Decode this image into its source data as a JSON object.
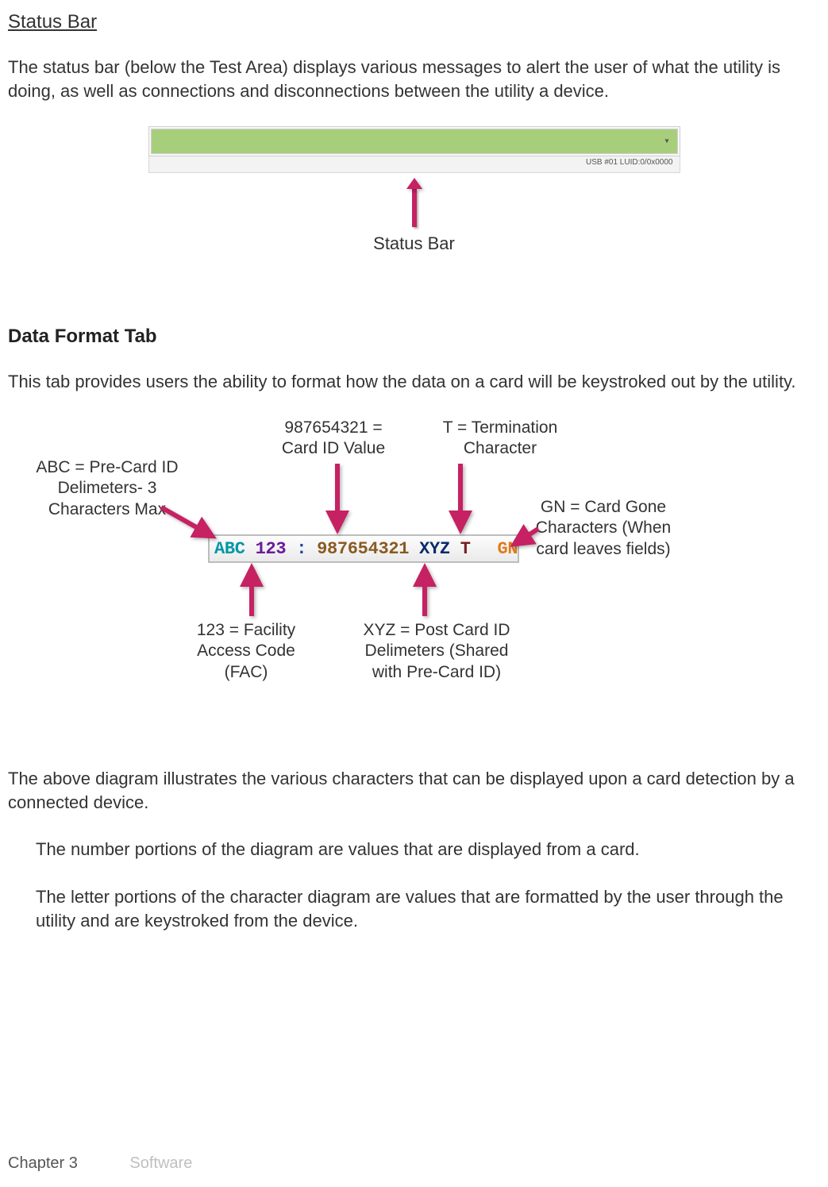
{
  "title": "Status Bar",
  "intro": "The status bar (below the Test Area) displays various messages to alert the user of what the utility is doing, as well as connections and disconnections between the utility a device.",
  "statusStripText": "USB #01 LUID:0/0x0000",
  "statusCaption": "Status Bar",
  "dataFormatHeading": "Data Format Tab",
  "dataFormatIntro": "This tab provides users the ability to format how the data on a card will be keystroked out by the utility.",
  "callouts": {
    "abc": "ABC = Pre-Card ID Delimeters- 3 Characters Max",
    "cid": "987654321 = Card ID Value",
    "term": "T = Termination Character",
    "gone": "GN = Card Gone Characters (When card leaves fields)",
    "fac": "123 = Facility Access Code (FAC)",
    "xyz": "XYZ = Post Card ID Delimeters (Shared with Pre-Card ID)"
  },
  "formatParts": {
    "abc": "ABC",
    "fac": "123",
    "colon": ":",
    "cid": "987654321",
    "xyz": "XYZ",
    "term": "T",
    "gone": "GN"
  },
  "afterDiagram1": "The above diagram illustrates the various characters that can be displayed upon a card detection by a connected device.",
  "afterDiagram2": "The number portions of the diagram are values that are displayed from a card.",
  "afterDiagram3": "The letter portions of the character diagram are values that are formatted by the user through the utility and are keystroked from the device.",
  "footerChapter": "Chapter 3",
  "footerSection": "Software"
}
